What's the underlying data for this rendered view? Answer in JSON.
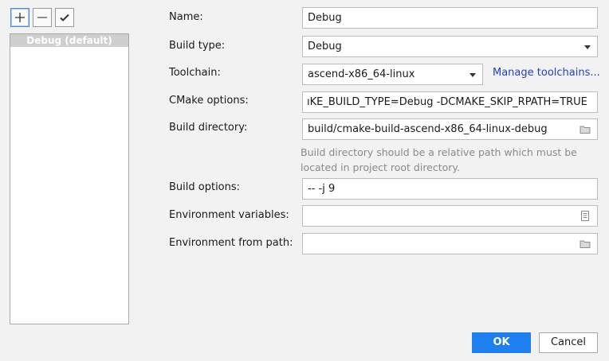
{
  "toolbar": {
    "add_icon": "plus-icon",
    "remove_icon": "minus-icon",
    "apply_icon": "checkmark-icon"
  },
  "profiles": {
    "items": [
      {
        "label": "Debug (default)"
      }
    ]
  },
  "form": {
    "name": {
      "label": "Name:",
      "value": "Debug"
    },
    "build_type": {
      "label": "Build type:",
      "value": "Debug"
    },
    "toolchain": {
      "label": "Toolchain:",
      "value": "ascend-x86_64-linux",
      "link": "Manage toolchains..."
    },
    "cmake_options": {
      "label": "CMake options:",
      "value": "ıKE_BUILD_TYPE=Debug -DCMAKE_SKIP_RPATH=TRUE"
    },
    "build_directory": {
      "label": "Build directory:",
      "value": "build/cmake-build-ascend-x86_64-linux-debug",
      "hint": "Build directory should be a relative path which must be located in project root directory."
    },
    "build_options": {
      "label": "Build options:",
      "value": "-- -j 9"
    },
    "env_vars": {
      "label": "Environment variables:",
      "value": ""
    },
    "env_from_path": {
      "label": "Environment from path:",
      "value": ""
    }
  },
  "buttons": {
    "ok": "OK",
    "cancel": "Cancel"
  },
  "colors": {
    "accent": "#1e7ff0",
    "link": "#2340c8",
    "selection": "#cfcfcf"
  }
}
